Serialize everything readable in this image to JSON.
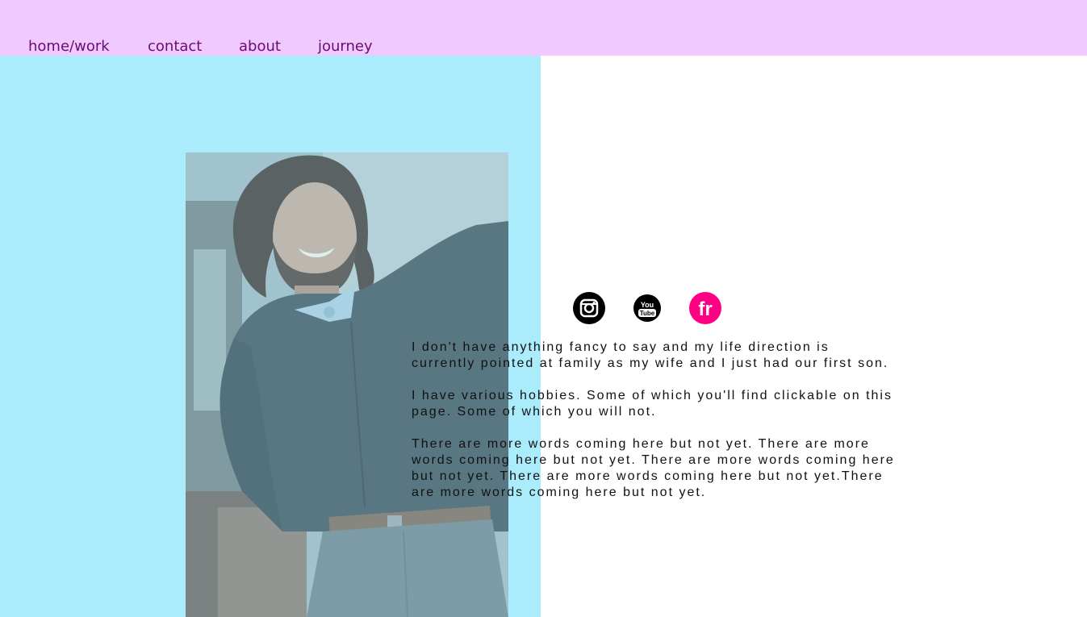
{
  "nav": {
    "items": [
      {
        "label": "home/work"
      },
      {
        "label": "contact"
      },
      {
        "label": "about"
      },
      {
        "label": "journey"
      }
    ]
  },
  "colors": {
    "nav_background": "#f0c9fe",
    "nav_text": "#6a0c72",
    "panel_background": "#aaebfc",
    "flickr_pink": "#ff0084"
  },
  "social": {
    "instagram_icon": "instagram-icon",
    "youtube_icon": "youtube-icon",
    "youtube_top": "You",
    "youtube_bottom": "Tube",
    "flickr_icon": "flickr-icon",
    "flickr_text": "fr"
  },
  "bio": {
    "paragraphs": [
      "I don't have anything fancy to say and my life direction is currently pointed at family as my wife and I just had our first son.",
      "I have various hobbies. Some of which you'll find clickable on this page. Some of which you will not.",
      "There are more words coming here but not yet. There are more words coming here but not yet. There are more words coming here but not yet. There are more words coming here but not yet.There are more words coming here but not yet."
    ]
  }
}
